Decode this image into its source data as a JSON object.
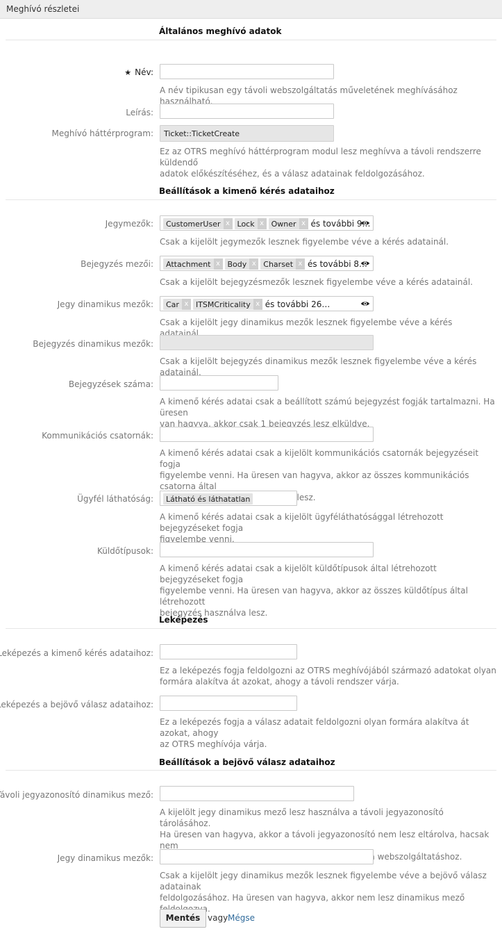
{
  "panel": {
    "title": "Meghívó részletei"
  },
  "sections": {
    "general": "Általános meghívó adatok",
    "outgoing": "Beállítások a kimenő kérés adataihoz",
    "mapping": "Leképezés",
    "incoming": "Beállítások a bejövő válasz adataihoz"
  },
  "general": {
    "name_label": "Név:",
    "name_required_marker": "★",
    "name_value": "",
    "name_hint": "A név tipikusan egy távoli webszolgáltatás műveletének meghívásához használható.",
    "description_label": "Leírás:",
    "description_value": "",
    "backend_label": "Meghívó háttérprogram:",
    "backend_value": "Ticket::TicketCreate",
    "backend_hint_1": "Ez az OTRS meghívó háttérprogram modul lesz meghívva a távoli rendszerre küldendő",
    "backend_hint_2": "adatok előkészítéséhez, és a válasz adatainak feldolgozásához."
  },
  "outgoing": {
    "ticket_fields_label": "Jegymezők:",
    "ticket_fields_tags": [
      "CustomerUser",
      "Lock",
      "Owner"
    ],
    "ticket_fields_more": "és további 9…",
    "ticket_fields_hint": "Csak a kijelölt jegymezők lesznek figyelembe véve a kérés adatainál.",
    "article_fields_label": "Bejegyzés mezői:",
    "article_fields_tags": [
      "Attachment",
      "Body",
      "Charset"
    ],
    "article_fields_more": "és további 8…",
    "article_fields_hint": "Csak a kijelölt bejegyzésmezők lesznek figyelembe véve a kérés adatainál.",
    "ticket_dyn_label": "Jegy dinamikus mezők:",
    "ticket_dyn_tags": [
      "Car",
      "ITSMCriticality"
    ],
    "ticket_dyn_more": "és további 26…",
    "ticket_dyn_hint": "Csak a kijelölt jegy dinamikus mezők lesznek figyelembe véve a kérés adatainál.",
    "article_dyn_label": "Bejegyzés dinamikus mezők:",
    "article_dyn_hint": "Csak a kijelölt bejegyzés dinamikus mezők lesznek figyelembe véve a kérés adatainál.",
    "article_count_label": "Bejegyzések száma:",
    "article_count_value": "",
    "article_count_hint_1": "A kimenő kérés adatai csak a beállított számú bejegyzést fogják tartalmazni. Ha üresen",
    "article_count_hint_2": "van hagyva, akkor csak 1 bejegyzés lesz elküldve.",
    "channels_label": "Kommunikációs csatornák:",
    "channels_hint_1": "A kimenő kérés adatai csak a kijelölt kommunikációs csatornák bejegyzéseit fogja",
    "channels_hint_2": "figyelembe venni. Ha üresen van hagyva, akkor az összes kommunikációs csatorna által",
    "channels_hint_3": "létrehozott bejegyzés használva lesz.",
    "visibility_label": "Ügyfél láthatóság:",
    "visibility_tag": "Látható és láthatatlan",
    "visibility_hint_1": "A kimenő kérés adatai csak a kijelölt ügyféláthatósággal létrehozott bejegyzéseket fogja",
    "visibility_hint_2": "figyelembe venni.",
    "sender_label": "Küldőtípusok:",
    "sender_hint_1": "A kimenő kérés adatai csak a kijelölt küldőtípusok által létrehozott bejegyzéseket fogja",
    "sender_hint_2": "figyelembe venni. Ha üresen van hagyva, akkor az összes küldőtípus által létrehozott",
    "sender_hint_3": "bejegyzés használva lesz."
  },
  "mapping": {
    "outgoing_label": "Leképezés a kimenő kérés adataihoz:",
    "outgoing_hint_1": "Ez a leképezés fogja feldolgozni az OTRS meghívójából származó adatokat olyan",
    "outgoing_hint_2": "formára alakítva át azokat, ahogy a távoli rendszer várja.",
    "incoming_label": "Leképezés a bejövő válasz adataihoz:",
    "incoming_hint_1": "Ez a leképezés fogja a válasz adatait feldolgozni olyan formára alakítva át azokat, ahogy",
    "incoming_hint_2": "az OTRS meghívója várja."
  },
  "incoming": {
    "remote_id_label": "Távoli jegyazonosító dinamikus mező:",
    "remote_id_hint_1": "A kijelölt jegy dinamikus mező lesz használva a távoli jegyazonosító tárolásához.",
    "remote_id_hint_2": "Ha üresen van hagyva, akkor a távoli jegyazonosító nem lesz eltárolva, hacsak nem",
    "remote_id_hint_3": "határoz meg egy rendszerbeállítási értéket ehhez a webszolgáltatáshoz.",
    "ticket_dyn_label": "Jegy dinamikus mezők:",
    "ticket_dyn_hint_1": "Csak a kijelölt jegy dinamikus mezők lesznek figyelembe véve a bejövő válasz adatainak",
    "ticket_dyn_hint_2": "feldolgozásához. Ha üresen van hagyva, akkor nem lesz dinamikus mező feldolgozva."
  },
  "actions": {
    "save_label": "Mentés",
    "or_label": "vagy",
    "cancel_label": "Mégse"
  }
}
